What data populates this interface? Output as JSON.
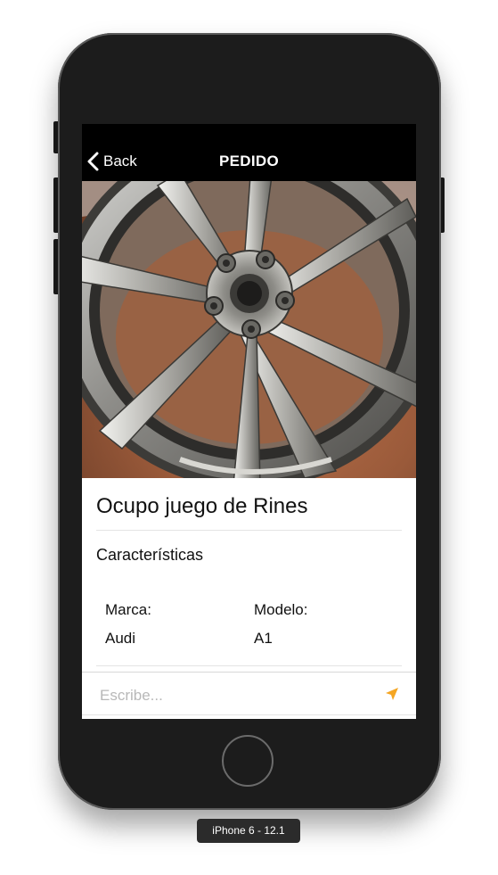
{
  "nav": {
    "back_label": "Back",
    "title": "PEDIDO"
  },
  "product": {
    "image_icon": "rim-photo",
    "title": "Ocupo juego de Rines",
    "section_title": "Características",
    "specs": [
      {
        "label": "Marca:",
        "value": "Audi"
      },
      {
        "label": "Modelo:",
        "value": "A1"
      }
    ]
  },
  "message": {
    "placeholder": "Escribe...",
    "value": "",
    "send_icon": "paper-plane-icon",
    "accent_color": "#f5a623"
  },
  "device": {
    "label": "iPhone 6 - 12.1"
  }
}
